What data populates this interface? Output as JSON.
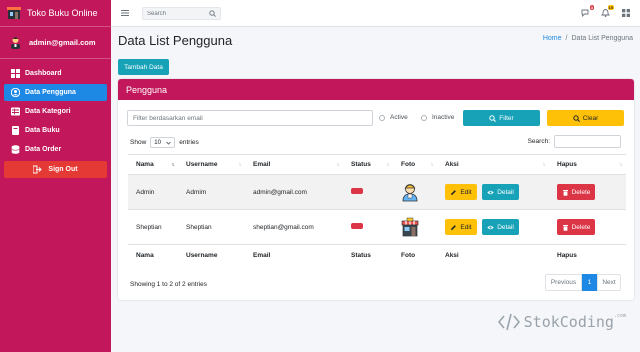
{
  "app": {
    "brand": "Toko Buku Online",
    "user": "admin@gmail.com"
  },
  "sidebar": {
    "items": [
      {
        "label": "Dashboard",
        "active": false
      },
      {
        "label": "Data Pengguna",
        "active": true
      },
      {
        "label": "Data Kategori",
        "active": false
      },
      {
        "label": "Data Buku",
        "active": false
      },
      {
        "label": "Data Order",
        "active": false
      }
    ],
    "signout": "Sign Out"
  },
  "topbar": {
    "search_placeholder": "Search",
    "messages_badge": "3",
    "notifications_badge": "15"
  },
  "page": {
    "title": "Data List Pengguna",
    "breadcrumb": {
      "home": "Home",
      "separator": "/",
      "current": "Data List Pengguna"
    },
    "add_button": "Tambah Data"
  },
  "card": {
    "title": "Pengguna",
    "filter_placeholder": "Filter berdasarkan email",
    "radio_active": "Active",
    "radio_inactive": "Inactive",
    "filter_button": "Filter",
    "clear_button": "Clear",
    "show_label": "Show",
    "entries_value": "10",
    "entries_label": "entries",
    "search_label": "Search:",
    "columns": [
      "Nama",
      "Username",
      "Email",
      "Status",
      "Foto",
      "Aksi",
      "Hapus"
    ],
    "rows": [
      {
        "nama": "Admin",
        "username": "Admim",
        "email": "admin@gmail.com",
        "status": "inactive",
        "photo": "admin-avatar"
      },
      {
        "nama": "Sheptian",
        "username": "Sheptian",
        "email": "sheptian@gmail.com",
        "status": "inactive",
        "photo": "shop-icon"
      }
    ],
    "edit_label": "Edit",
    "detail_label": "Detail",
    "delete_label": "Delete",
    "showing_text": "Showing 1 to 2 of 2 entries",
    "pager": {
      "previous": "Previous",
      "current": "1",
      "next": "Next"
    }
  },
  "watermark": {
    "text": "StokCoding",
    "suffix": ".com"
  },
  "colors": {
    "sidebar": "#c2185b",
    "active_nav": "#1e88e5",
    "info": "#17a2b8",
    "warning": "#ffc107",
    "danger": "#dc3545"
  }
}
